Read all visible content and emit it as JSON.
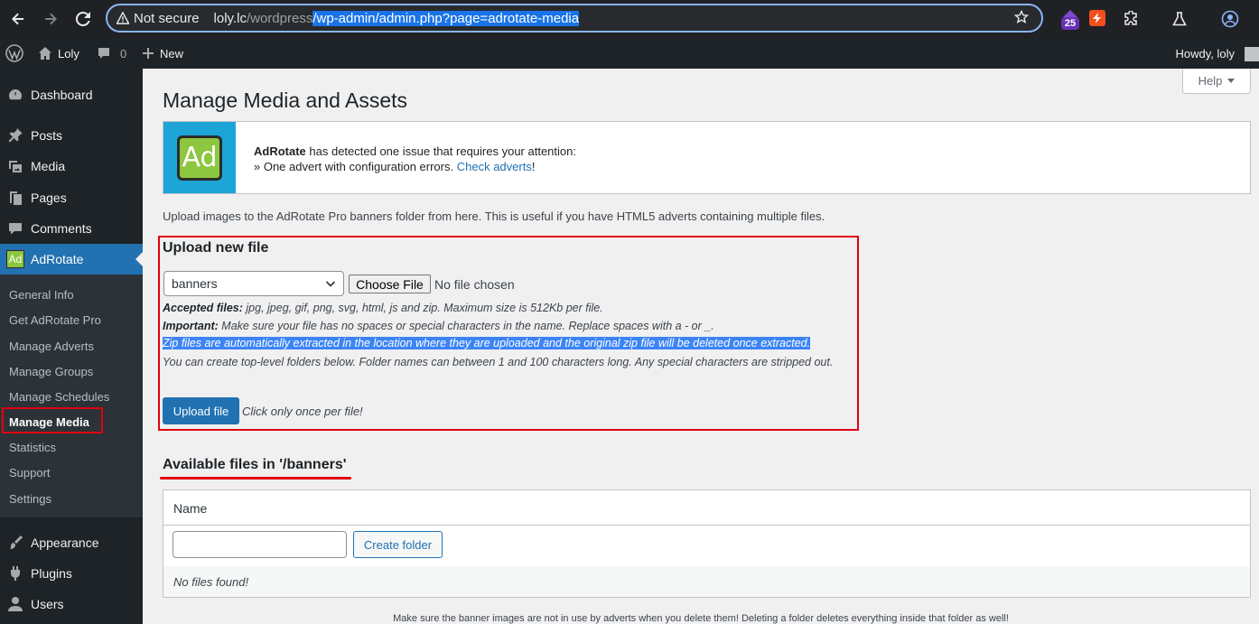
{
  "browser": {
    "security_label": "Not secure",
    "url_host": "loly.lc",
    "url_dim": "/wordpress",
    "url_selected": "/wp-admin/admin.php?page=adrotate-media",
    "extension_badge": "25"
  },
  "adminbar": {
    "site_name": "Loly",
    "comments_count": "0",
    "new_label": "New",
    "howdy": "Howdy, loly"
  },
  "sidebar": {
    "items": [
      {
        "label": "Dashboard",
        "icon": "dashboard-icon"
      },
      {
        "label": "Posts",
        "icon": "pin-icon"
      },
      {
        "label": "Media",
        "icon": "media-icon"
      },
      {
        "label": "Pages",
        "icon": "pages-icon"
      },
      {
        "label": "Comments",
        "icon": "comment-icon"
      },
      {
        "label": "AdRotate",
        "icon": "adrotate-icon"
      }
    ],
    "submenu": [
      "General Info",
      "Get AdRotate Pro",
      "Manage Adverts",
      "Manage Groups",
      "Manage Schedules",
      "Manage Media",
      "Statistics",
      "Support",
      "Settings"
    ],
    "bottom_items": [
      {
        "label": "Appearance",
        "icon": "brush-icon"
      },
      {
        "label": "Plugins",
        "icon": "plug-icon"
      },
      {
        "label": "Users",
        "icon": "user-icon"
      }
    ],
    "adrotate_icon_text": "Ad"
  },
  "help_label": "Help",
  "page_title": "Manage Media and Assets",
  "notice": {
    "logo_text": "Ad",
    "brand": "AdRotate",
    "line1_rest": " has detected one issue that requires your attention:",
    "line2_prefix": "» One advert with configuration errors. ",
    "line2_link": "Check adverts",
    "line2_suffix": "!"
  },
  "intro": "Upload images to the AdRotate Pro banners folder from here. This is useful if you have HTML5 adverts containing multiple files.",
  "upload": {
    "title": "Upload new file",
    "folder_selected": "banners",
    "choose_file_label": "Choose File",
    "no_file_label": "No file chosen",
    "accepted_label": "Accepted files:",
    "accepted_text": " jpg, jpeg, gif, png, svg, html, js and zip. Maximum size is 512Kb per file.",
    "important_label": "Important:",
    "important_text": " Make sure your file has no spaces or special characters in the name. Replace spaces with a - or _.",
    "zip_note": "Zip files are automatically extracted in the location where they are uploaded and the original zip file will be deleted once extracted.",
    "folder_note": "You can create top-level folders below. Folder names can between 1 and 100 characters long. Any special characters are stripped out.",
    "button_label": "Upload file",
    "hint": "Click only once per file!"
  },
  "files": {
    "title": "Available files in '/banners'",
    "column_name": "Name",
    "create_folder_label": "Create folder",
    "empty_message": "No files found!"
  },
  "footer_note": "Make sure the banner images are not in use by adverts when you delete them! Deleting a folder deletes everything inside that folder as well!",
  "colors": {
    "accent": "#2271b1",
    "sidebar_bg": "#1d2327",
    "highlight_red": "#e10010"
  }
}
